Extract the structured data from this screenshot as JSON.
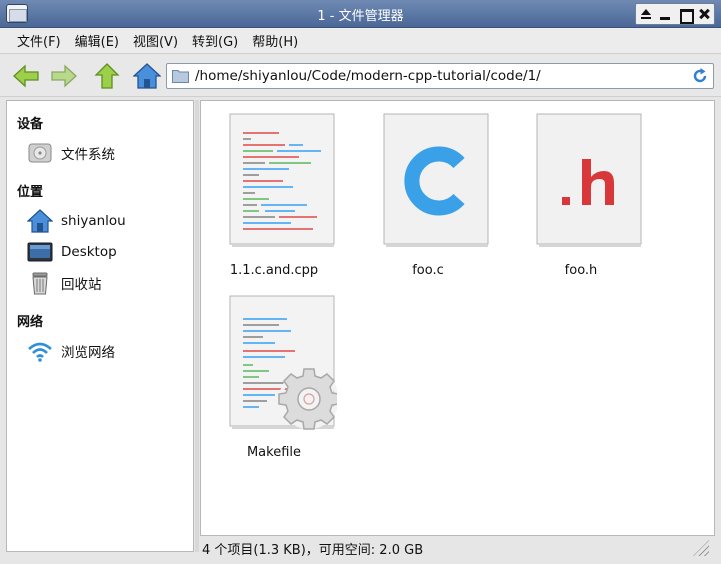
{
  "window": {
    "title": "1 - 文件管理器"
  },
  "menu": [
    {
      "label": "文件(F)"
    },
    {
      "label": "编辑(E)"
    },
    {
      "label": "视图(V)"
    },
    {
      "label": "转到(G)"
    },
    {
      "label": "帮助(H)"
    }
  ],
  "toolbar": {
    "back_icon": "arrow-left-icon",
    "forward_icon": "arrow-right-icon",
    "up_icon": "arrow-up-icon",
    "home_icon": "home-icon",
    "location": "/home/shiyanlou/Code/modern-cpp-tutorial/code/1/"
  },
  "sidebar": {
    "devices_heading": "设备",
    "devices": [
      {
        "label": "文件系统",
        "icon": "drive-icon"
      }
    ],
    "places_heading": "位置",
    "places": [
      {
        "label": "shiyanlou",
        "icon": "home-icon"
      },
      {
        "label": "Desktop",
        "icon": "desktop-icon"
      },
      {
        "label": "回收站",
        "icon": "trash-icon"
      }
    ],
    "network_heading": "网络",
    "network": [
      {
        "label": "浏览网络",
        "icon": "wifi-icon"
      }
    ]
  },
  "files": [
    {
      "name": "1.1.c.and.cpp",
      "icon": "text-file-icon"
    },
    {
      "name": "foo.c",
      "icon": "c-source-icon"
    },
    {
      "name": "foo.h",
      "icon": "header-file-icon"
    },
    {
      "name": "Makefile",
      "icon": "makefile-icon"
    }
  ],
  "status": {
    "text": "4 个项目(1.3 KB)，可用空间: 2.0 GB"
  },
  "colors": {
    "titlebar": "#5a77a5",
    "arrow_green": "#8dc63f",
    "home_blue": "#3b7fd0",
    "c_blue": "#3aa0e8",
    "h_red": "#d9383a"
  }
}
